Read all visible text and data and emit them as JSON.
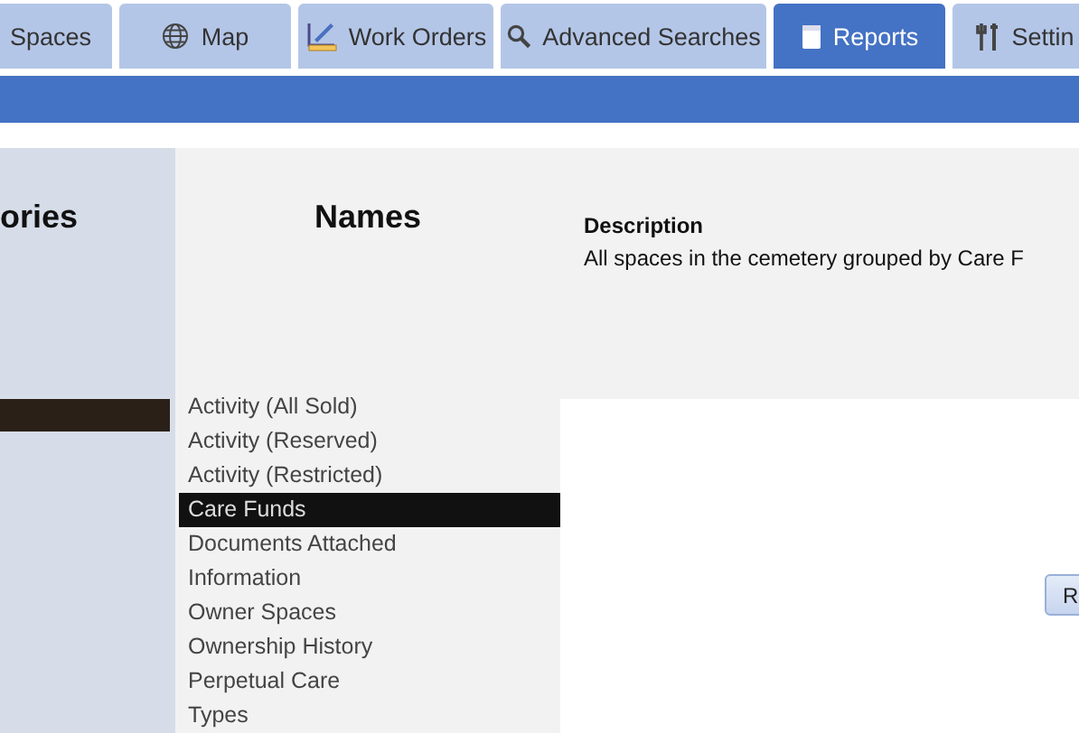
{
  "tabs": [
    {
      "label": "Spaces",
      "selected": false
    },
    {
      "label": "Map",
      "selected": false
    },
    {
      "label": "Work Orders",
      "selected": false
    },
    {
      "label": "Advanced Searches",
      "selected": false
    },
    {
      "label": "Reports",
      "selected": true
    },
    {
      "label": "Settin",
      "selected": false
    }
  ],
  "categories": {
    "heading": "ories",
    "items": [
      {
        "selected": true
      }
    ]
  },
  "names": {
    "heading": "Names",
    "items": [
      {
        "label": "Activity (All Sold)",
        "selected": false
      },
      {
        "label": "Activity (Reserved)",
        "selected": false
      },
      {
        "label": "Activity (Restricted)",
        "selected": false
      },
      {
        "label": "Care Funds",
        "selected": true
      },
      {
        "label": "Documents Attached",
        "selected": false
      },
      {
        "label": "Information",
        "selected": false
      },
      {
        "label": "Owner Spaces",
        "selected": false
      },
      {
        "label": "Ownership History",
        "selected": false
      },
      {
        "label": "Perpetual Care",
        "selected": false
      },
      {
        "label": "Types",
        "selected": false
      }
    ]
  },
  "description": {
    "label": "Description",
    "text": "All spaces in the cemetery grouped by Care F"
  },
  "run_button": {
    "label": "R"
  }
}
